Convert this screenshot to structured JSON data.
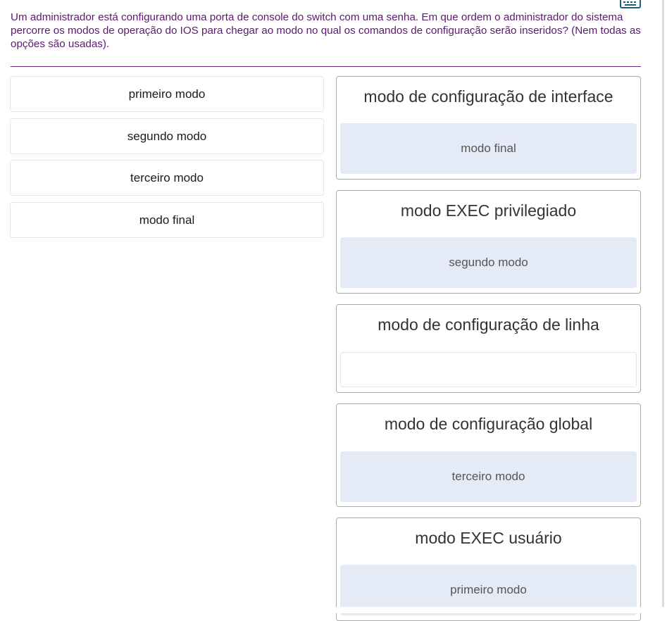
{
  "question": "Um administrador está configurando uma porta de console do switch com uma senha. Em que ordem o administrador do sistema percorre os modos de operação do IOS para chegar ao modo no qual os comandos de configuração serão inseridos? (Nem todas as opções são usadas).",
  "options": [
    {
      "label": "primeiro modo"
    },
    {
      "label": "segundo modo"
    },
    {
      "label": "terceiro modo"
    },
    {
      "label": "modo final"
    }
  ],
  "targets": [
    {
      "title": "modo de configuração de interface",
      "value": "modo final"
    },
    {
      "title": "modo EXEC privilegiado",
      "value": "segundo modo"
    },
    {
      "title": "modo de configuração de linha",
      "value": ""
    },
    {
      "title": "modo de configuração global",
      "value": "terceiro modo"
    },
    {
      "title": "modo EXEC usuário",
      "value": "primeiro modo"
    }
  ],
  "colors": {
    "question_text": "#5b1a6e",
    "divider": "#6b2a7e",
    "filled_drop_bg": "#e4ebf7",
    "keyboard_icon": "#1f5e7a"
  },
  "icons": {
    "accessibility_keyboard": "keyboard-icon"
  }
}
